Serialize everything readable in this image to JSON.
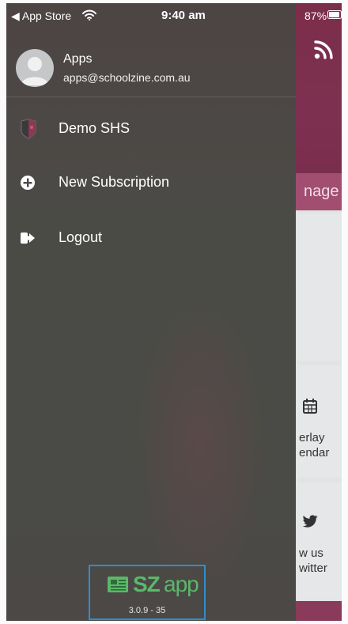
{
  "status_bar": {
    "back_label": "◀ App Store",
    "time": "9:40 am",
    "battery": "87%"
  },
  "drawer": {
    "profile": {
      "name": "Apps",
      "email": "apps@schoolzine.com.au"
    },
    "items": [
      {
        "label": "Demo SHS",
        "icon": "school-logo-icon"
      },
      {
        "label": "New Subscription",
        "icon": "plus-circle-icon"
      },
      {
        "label": "Logout",
        "icon": "logout-icon"
      }
    ],
    "footer": {
      "brand_sz": "SZ",
      "brand_app": "app",
      "version": "3.0.9 - 35"
    }
  },
  "background_app": {
    "tab_partial": "nage",
    "tile_2_lines": [
      "erlay",
      "endar"
    ],
    "tile_3_lines": [
      "w us",
      "witter"
    ]
  },
  "colors": {
    "header": "#7b2e49",
    "tab_strip": "#a14e70",
    "drawer": "#4b4b46",
    "brand_green": "#5bb86a",
    "highlight_box": "#2d8ecf"
  }
}
